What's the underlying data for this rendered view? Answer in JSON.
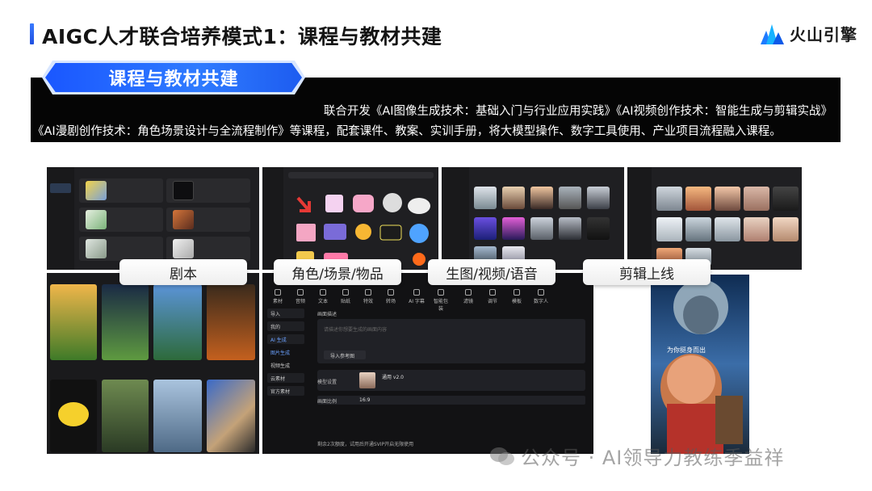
{
  "title": "AIGC人才联合培养模式1：课程与教材共建",
  "logo_text": "火山引擎",
  "section_tag": "课程与教材共建",
  "description": {
    "line1": "联合开发《AI图像生成技术：基础入门与行业应用实践》《AI视频创作技术：智能生成与剪辑实战》",
    "line2": "《AI漫剧创作技术：角色场景设计与全流程制作》等课程，配套课件、教案、实训手册，将大模型操作、数字工具使用、产业项目流程融入课程。"
  },
  "stage_labels": [
    "剧本",
    "角色/场景/物品",
    "生图/视频/语音",
    "剪辑上线"
  ],
  "editor": {
    "tools": [
      "素材",
      "音频",
      "文本",
      "贴纸",
      "特效",
      "转场",
      "AI 字幕",
      "智能包装",
      "滤镜",
      "调节",
      "模板",
      "数字人"
    ],
    "menu": [
      "导入",
      "我的",
      "AI 生成",
      "图片生成",
      "视频生成",
      "云素材",
      "官方素材"
    ],
    "prompt_label": "画面描述",
    "prompt_placeholder": "请描述你想要生成的画面内容",
    "ref_button": "导入参考图",
    "model_label": "模型设置",
    "model_name": "通用 v2.0",
    "ratio_label": "画面比例",
    "ratio_value": "16:9",
    "tip": "剩余2次额度，试用后开通SVIP开启无限使用"
  },
  "poster_caption": "为你挺身而出",
  "watermark": "公众号 · AI领导力教练季益祥"
}
